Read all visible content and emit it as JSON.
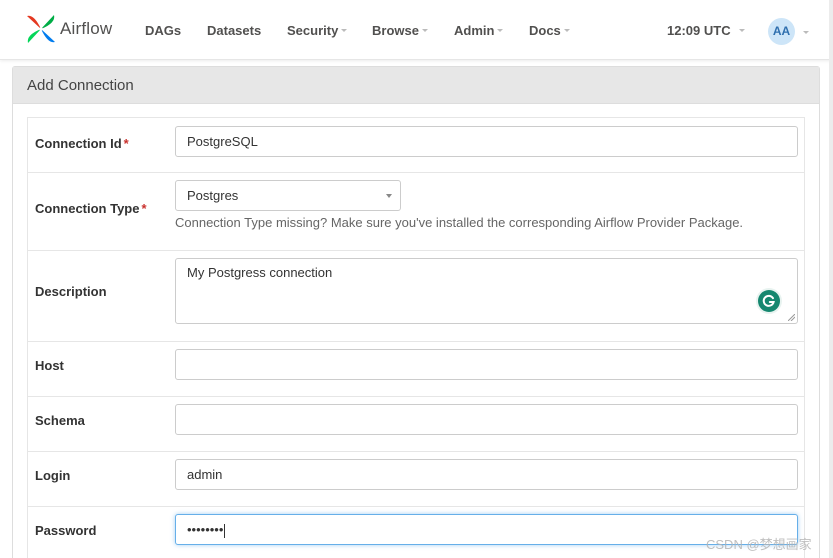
{
  "navbar": {
    "brand": "Airflow",
    "items": [
      {
        "label": "DAGs",
        "dropdown": false
      },
      {
        "label": "Datasets",
        "dropdown": false
      },
      {
        "label": "Security",
        "dropdown": true
      },
      {
        "label": "Browse",
        "dropdown": true
      },
      {
        "label": "Admin",
        "dropdown": true
      },
      {
        "label": "Docs",
        "dropdown": true
      }
    ],
    "time": "12:09 UTC",
    "user_initials": "AA"
  },
  "panel": {
    "title": "Add Connection"
  },
  "form": {
    "conn_id": {
      "label": "Connection Id",
      "required": "*",
      "value": "PostgreSQL"
    },
    "conn_type": {
      "label": "Connection Type",
      "required": "*",
      "value": "Postgres",
      "help": "Connection Type missing? Make sure you've installed the corresponding Airflow Provider Package."
    },
    "description": {
      "label": "Description",
      "value": "My Postgress connection"
    },
    "host": {
      "label": "Host",
      "value": ""
    },
    "schema": {
      "label": "Schema",
      "value": ""
    },
    "login": {
      "label": "Login",
      "value": "admin"
    },
    "password": {
      "label": "Password",
      "value": "••••••••"
    }
  },
  "watermark": "CSDN @梦想画家",
  "colors": {
    "required": "#c9302c",
    "focus": "#66afe9",
    "grammarly": "#15876f",
    "avatar_bg": "#cde5f8"
  }
}
